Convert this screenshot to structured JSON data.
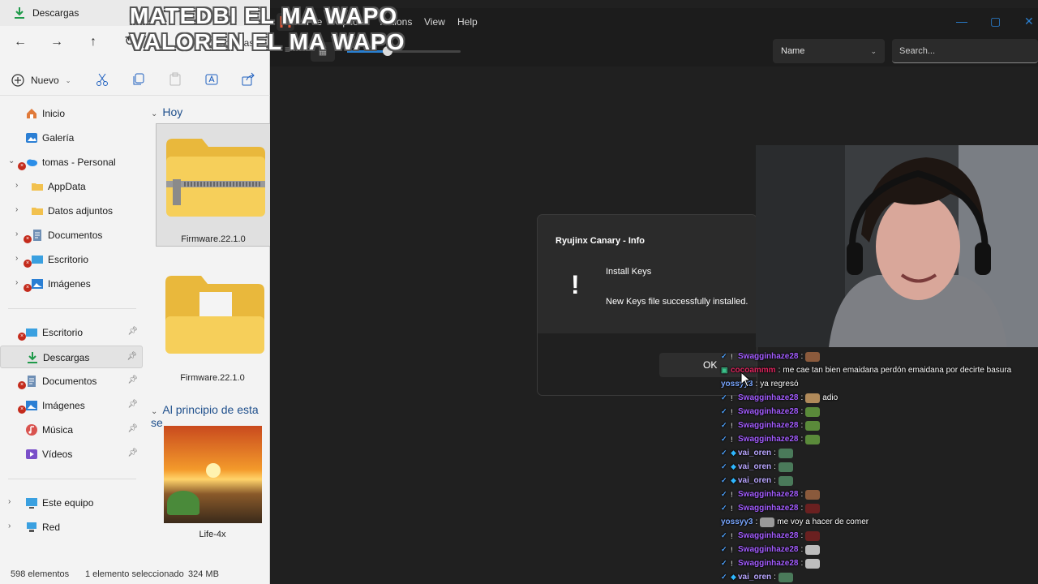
{
  "explorer": {
    "title": "Descargas",
    "address": "Descargas",
    "toolbar": {
      "new_label": "Nuevo"
    },
    "sidebar": {
      "items": [
        {
          "label": "Inicio",
          "icon": "home-icon",
          "indent": 1,
          "chevron": false,
          "error": false,
          "pinned": false
        },
        {
          "label": "Galería",
          "icon": "gallery-icon",
          "indent": 1,
          "chevron": false,
          "error": false,
          "pinned": false
        },
        {
          "label": "tomas - Personal",
          "icon": "onedrive-icon",
          "indent": 1,
          "chevron": "open",
          "error": true,
          "pinned": false
        },
        {
          "label": "AppData",
          "icon": "folder-icon",
          "indent": 2,
          "chevron": "closed",
          "error": false,
          "pinned": false
        },
        {
          "label": "Datos adjuntos",
          "icon": "folder-icon",
          "indent": 2,
          "chevron": "closed",
          "error": false,
          "pinned": false
        },
        {
          "label": "Documentos",
          "icon": "documents-icon",
          "indent": 2,
          "chevron": "closed",
          "error": true,
          "pinned": false
        },
        {
          "label": "Escritorio",
          "icon": "desktop-icon",
          "indent": 2,
          "chevron": "closed",
          "error": true,
          "pinned": false
        },
        {
          "label": "Imágenes",
          "icon": "pictures-icon",
          "indent": 2,
          "chevron": "closed",
          "error": true,
          "pinned": false
        },
        {
          "label": "Escritorio",
          "icon": "desktop-icon",
          "indent": 1,
          "chevron": false,
          "error": true,
          "pinned": true
        },
        {
          "label": "Descargas",
          "icon": "downloads-icon",
          "indent": 1,
          "chevron": false,
          "error": false,
          "pinned": true,
          "selected": true
        },
        {
          "label": "Documentos",
          "icon": "documents-icon",
          "indent": 1,
          "chevron": false,
          "error": true,
          "pinned": true
        },
        {
          "label": "Imágenes",
          "icon": "pictures-icon",
          "indent": 1,
          "chevron": false,
          "error": true,
          "pinned": true
        },
        {
          "label": "Música",
          "icon": "music-icon",
          "indent": 1,
          "chevron": false,
          "error": false,
          "pinned": true
        },
        {
          "label": "Vídeos",
          "icon": "videos-icon",
          "indent": 1,
          "chevron": false,
          "error": false,
          "pinned": true
        },
        {
          "label": "Este equipo",
          "icon": "computer-icon",
          "indent": 1,
          "chevron": "closed",
          "error": false,
          "pinned": false
        },
        {
          "label": "Red",
          "icon": "network-icon",
          "indent": 1,
          "chevron": "closed",
          "error": false,
          "pinned": false
        }
      ]
    },
    "groups": [
      {
        "label": "Hoy"
      },
      {
        "label": "Al principio de esta se"
      }
    ],
    "files": [
      {
        "name": "Firmware.22.1.0",
        "type": "zip-folder",
        "selected": true
      },
      {
        "name": "Firmware.22.1.0",
        "type": "folder",
        "selected": false
      },
      {
        "name": "Life-4x",
        "type": "image",
        "selected": false
      }
    ],
    "status": {
      "count": "598 elementos",
      "selection": "1 elemento seleccionado",
      "size": "324 MB"
    }
  },
  "ryujinx": {
    "menu": [
      "File",
      "Options",
      "Actions",
      "View",
      "Help"
    ],
    "sort": {
      "value": "Name"
    },
    "search": {
      "placeholder": "Search..."
    },
    "dialog": {
      "title": "Ryujinx Canary - Info",
      "heading": "Install Keys",
      "message": "New Keys file successfully installed.",
      "ok_label": "OK"
    }
  },
  "overlay": {
    "line1": "MATEDBI EL MA WAPO",
    "line2": "VALOREN EL MA WAPO"
  },
  "chat": {
    "messages": [
      {
        "user": "Swagginhaze28",
        "text": "",
        "color": "#a35cff",
        "badges": true,
        "emote": "#8a5a3c"
      },
      {
        "user": "cocoammm",
        "text": "me cae tan bien emaidana perdón emaidana por decirte basura",
        "color": "#e0245e",
        "badges": "sub",
        "emote": ""
      },
      {
        "user": "yossyy3",
        "text": "ya regresó",
        "color": "#7aa7ff",
        "badges": false,
        "emote": ""
      },
      {
        "user": "Swagginhaze28",
        "text": "adio",
        "color": "#a35cff",
        "badges": true,
        "emote": "#b08a5a"
      },
      {
        "user": "Swagginhaze28",
        "text": "",
        "color": "#a35cff",
        "badges": true,
        "emote": "#5a8a3a"
      },
      {
        "user": "Swagginhaze28",
        "text": "",
        "color": "#a35cff",
        "badges": true,
        "emote": "#5a8a3a"
      },
      {
        "user": "Swagginhaze28",
        "text": "",
        "color": "#a35cff",
        "badges": true,
        "emote": "#5a8a3a"
      },
      {
        "user": "vai_oren",
        "text": "",
        "color": "#b9a6ff",
        "badges": "vip",
        "emote": "#4a7a5a"
      },
      {
        "user": "vai_oren",
        "text": "",
        "color": "#b9a6ff",
        "badges": "vip",
        "emote": "#4a7a5a"
      },
      {
        "user": "vai_oren",
        "text": "",
        "color": "#b9a6ff",
        "badges": "vip",
        "emote": "#4a7a5a"
      },
      {
        "user": "Swagginhaze28",
        "text": "",
        "color": "#a35cff",
        "badges": true,
        "emote": "#8a5a3c"
      },
      {
        "user": "Swagginhaze28",
        "text": "",
        "color": "#a35cff",
        "badges": true,
        "emote": "#6a2020"
      },
      {
        "user": "yossyy3",
        "text": "me voy a hacer de comer",
        "color": "#7aa7ff",
        "badges": false,
        "emote": "#9a9a9a"
      },
      {
        "user": "Swagginhaze28",
        "text": "",
        "color": "#a35cff",
        "badges": true,
        "emote": "#6a2020"
      },
      {
        "user": "Swagginhaze28",
        "text": "",
        "color": "#a35cff",
        "badges": true,
        "emote": "#bdbdbd"
      },
      {
        "user": "Swagginhaze28",
        "text": "",
        "color": "#a35cff",
        "badges": true,
        "emote": "#bdbdbd"
      },
      {
        "user": "vai_oren",
        "text": "",
        "color": "#b9a6ff",
        "badges": "vip",
        "emote": "#4a7a5a"
      }
    ]
  },
  "colors": {
    "explorer_bg": "#f3f3f3",
    "ryujinx_bg": "#202020",
    "dialog_bg": "#2b2b2b",
    "accent": "#2a7fd0",
    "error_badge": "#c42b1c"
  }
}
